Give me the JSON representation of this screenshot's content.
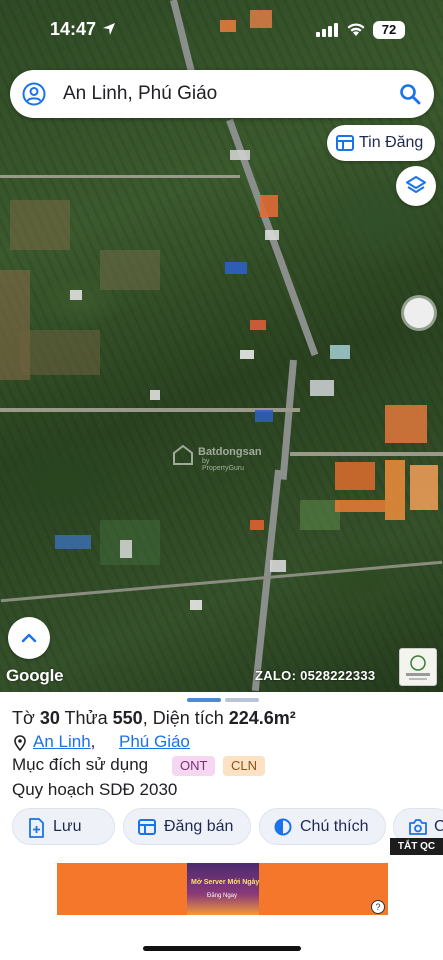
{
  "status_bar": {
    "time": "14:47",
    "battery": "72"
  },
  "search": {
    "text": "An Linh, Phú Giáo"
  },
  "map": {
    "post_button_label": "Tin Đăng",
    "watermark": "Batdongsan",
    "watermark_sub": "by PropertyGuru",
    "google_logo": "Google",
    "contact": "ZALO: 0528222333"
  },
  "parcel": {
    "title_prefix": "Tờ",
    "sheet_no": "30",
    "parcel_prefix": "Thửa",
    "parcel_no": "550",
    "area_prefix": ", Diện tích",
    "area": "224.6m²",
    "location": {
      "commune": "An Linh",
      "separator": ",",
      "district": "Phú Giáo"
    },
    "purpose_label": "Mục đích sử dụng",
    "tags": [
      "ONT",
      "CLN"
    ],
    "plan": "Quy hoạch SDĐ 2030"
  },
  "actions": [
    {
      "label": "Lưu",
      "icon": "bookmark-plus-icon"
    },
    {
      "label": "Đăng bán",
      "icon": "listing-icon"
    },
    {
      "label": "Chú thích",
      "icon": "half-circle-icon"
    },
    {
      "label": "C",
      "icon": "camera-icon"
    }
  ],
  "ad": {
    "close_label": "TẮT QC",
    "headline": "Mở Server Mới Ngày",
    "cta": "Đăng Ngay",
    "info": "?"
  },
  "colors": {
    "accent": "#1a73e8",
    "brand": "#1d2b52",
    "ad_orange": "#f4772c"
  }
}
